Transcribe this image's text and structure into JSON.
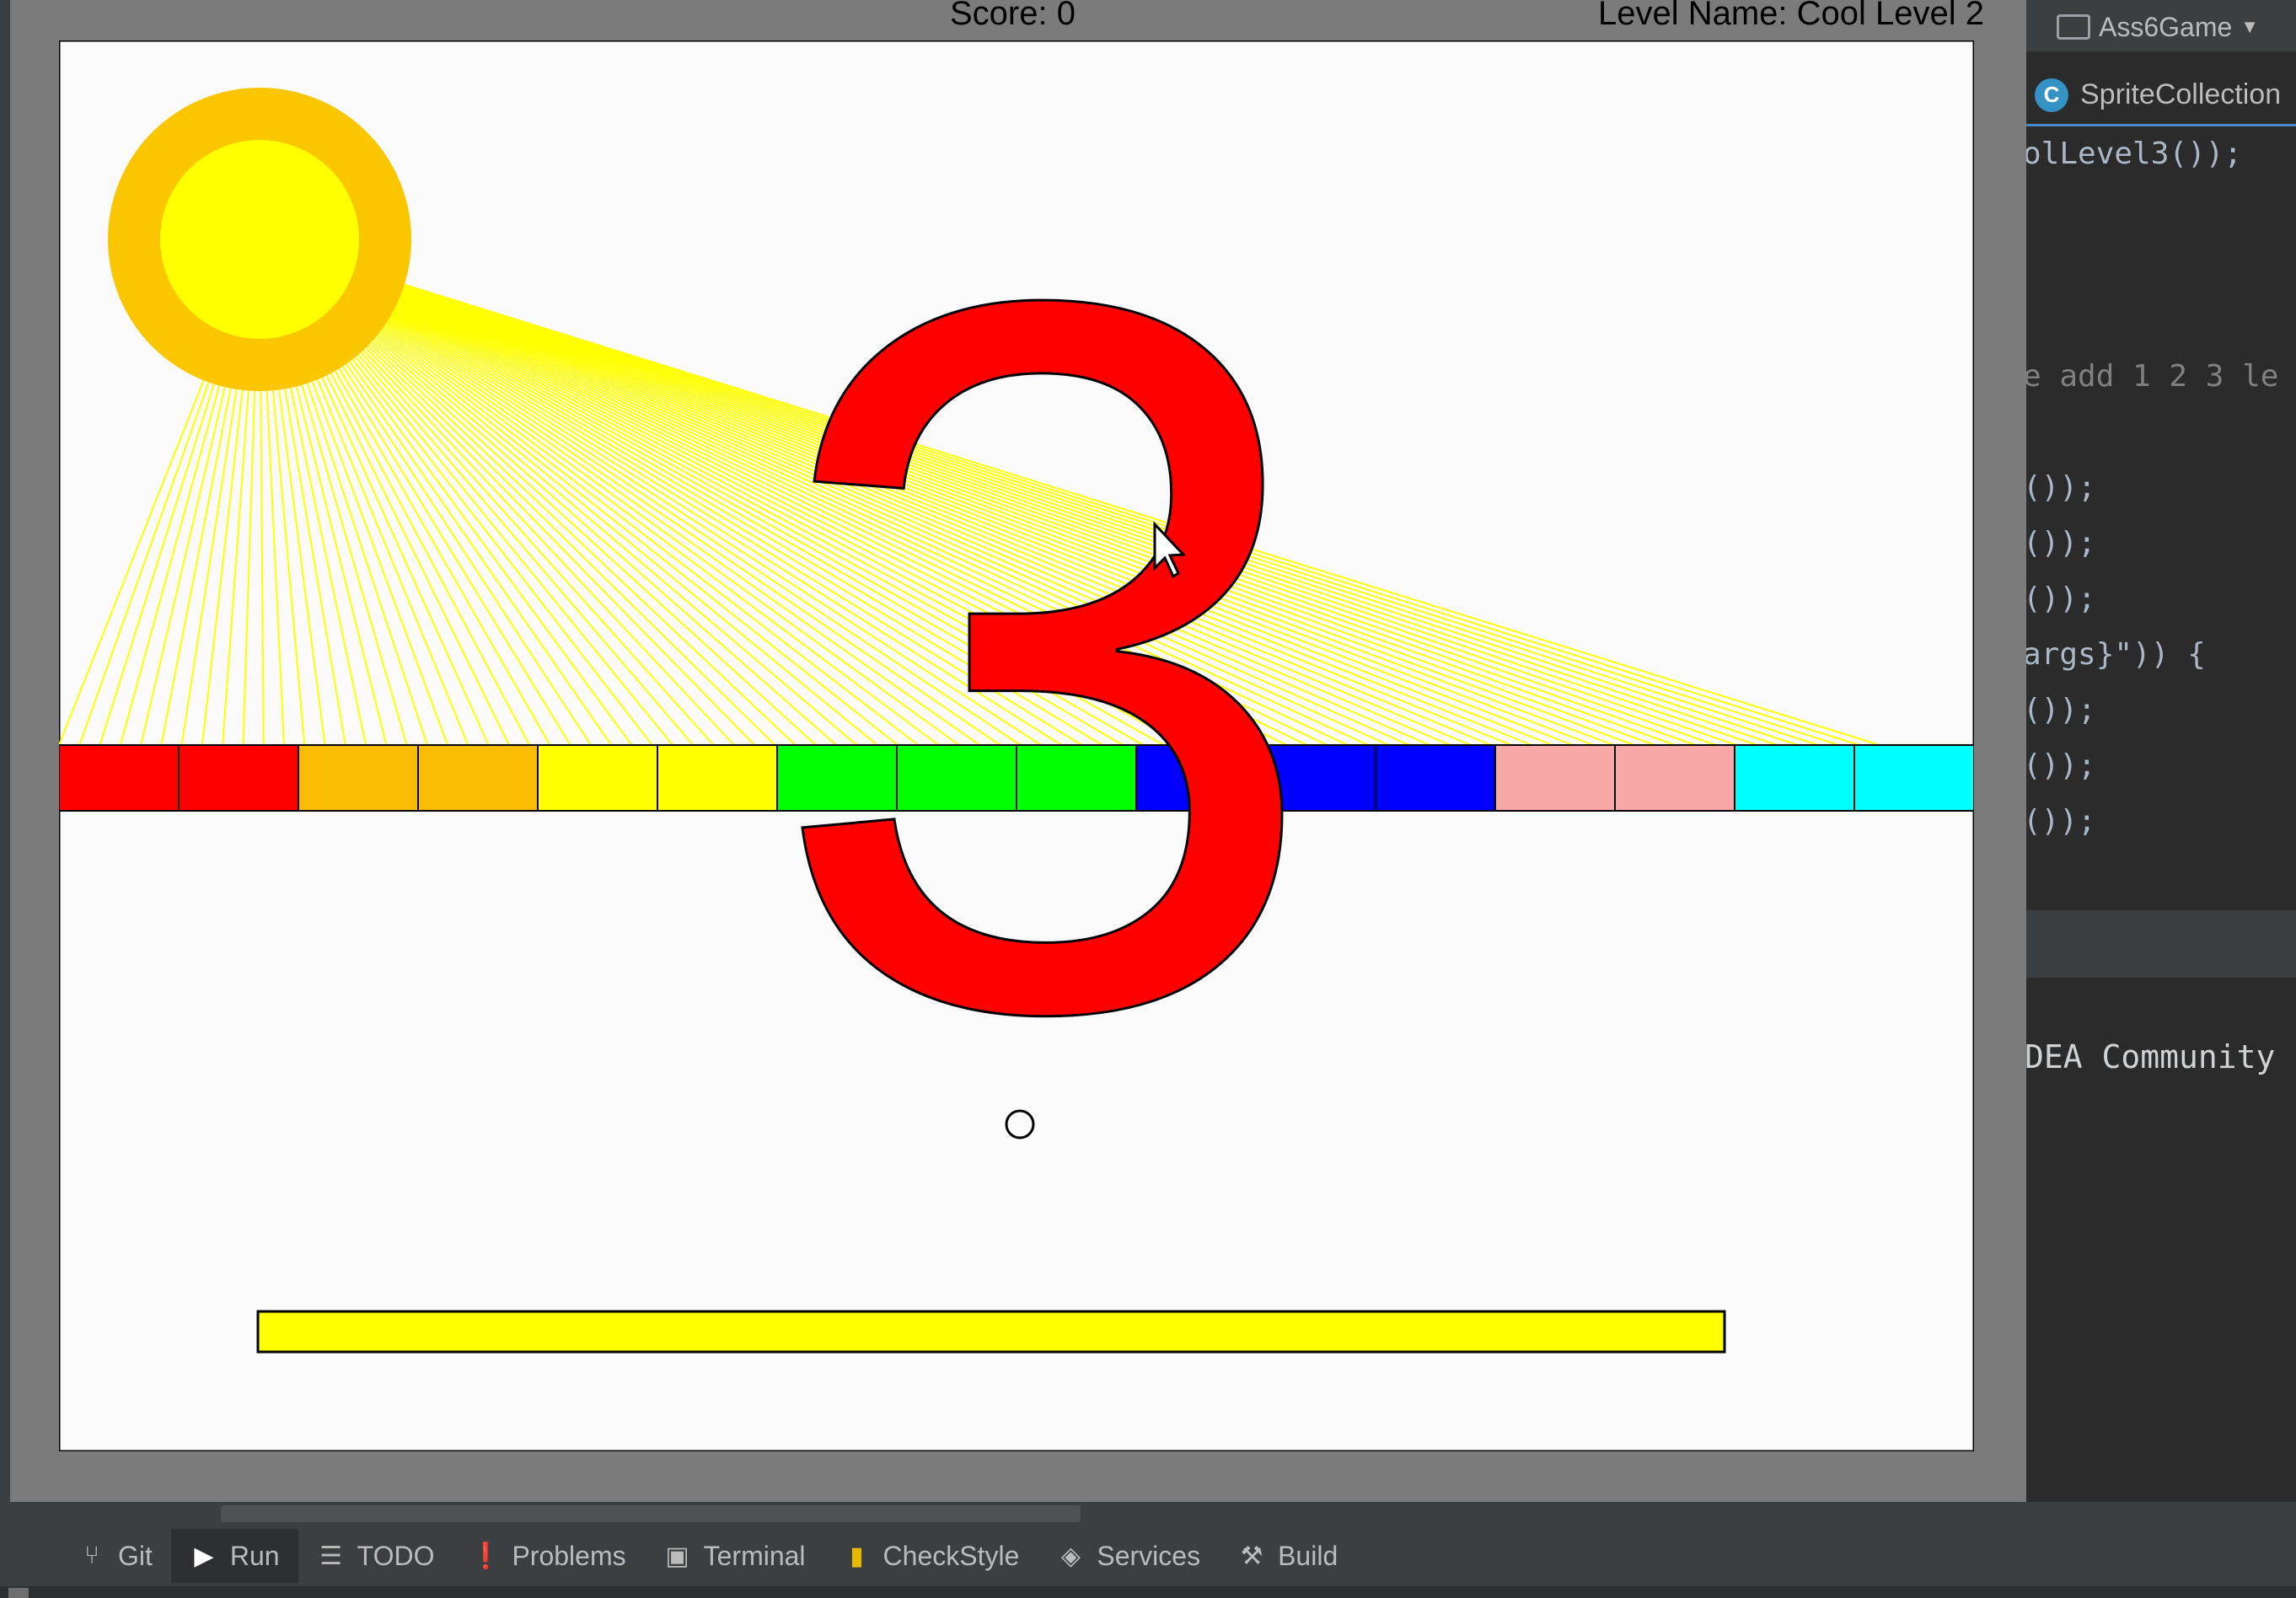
{
  "game": {
    "score_text": "Score: 0",
    "level_text": "Level Name: Cool Level 2",
    "countdown": "3",
    "block_colors": [
      "#ff0000",
      "#ff0000",
      "#f9bc02",
      "#f9bc02",
      "#ffff00",
      "#ffff00",
      "#00ff00",
      "#00ff00",
      "#00ff00",
      "#0000ff",
      "#0000ff",
      "#0000ff",
      "#f9a8a8",
      "#f9a8a8",
      "#00ffff",
      "#00ffff"
    ],
    "sun_outer_color": "#f9c600",
    "sun_inner_color": "#ffff00",
    "ray_color": "#ffff00",
    "paddle_color": "#ffff00",
    "background_color": "#fafafa"
  },
  "ide": {
    "run_config": "Ass6Game",
    "editor_tab": "SpriteCollection",
    "editor_tab_icon": "C",
    "code_lines": [
      "olLevel3());",
      "e add 1 2 3 le",
      "());",
      "());",
      "());",
      "args}\")) {",
      "());",
      "());",
      "());"
    ],
    "console_text": "DEA Community"
  },
  "toolbar": {
    "tabs": [
      {
        "label": "Git",
        "icon": "git-icon"
      },
      {
        "label": "Run",
        "icon": "run-icon"
      },
      {
        "label": "TODO",
        "icon": "list-icon"
      },
      {
        "label": "Problems",
        "icon": "problems-icon"
      },
      {
        "label": "Terminal",
        "icon": "terminal-icon"
      },
      {
        "label": "CheckStyle",
        "icon": "checkstyle-icon"
      },
      {
        "label": "Services",
        "icon": "services-icon"
      },
      {
        "label": "Build",
        "icon": "hammer-icon"
      }
    ]
  }
}
